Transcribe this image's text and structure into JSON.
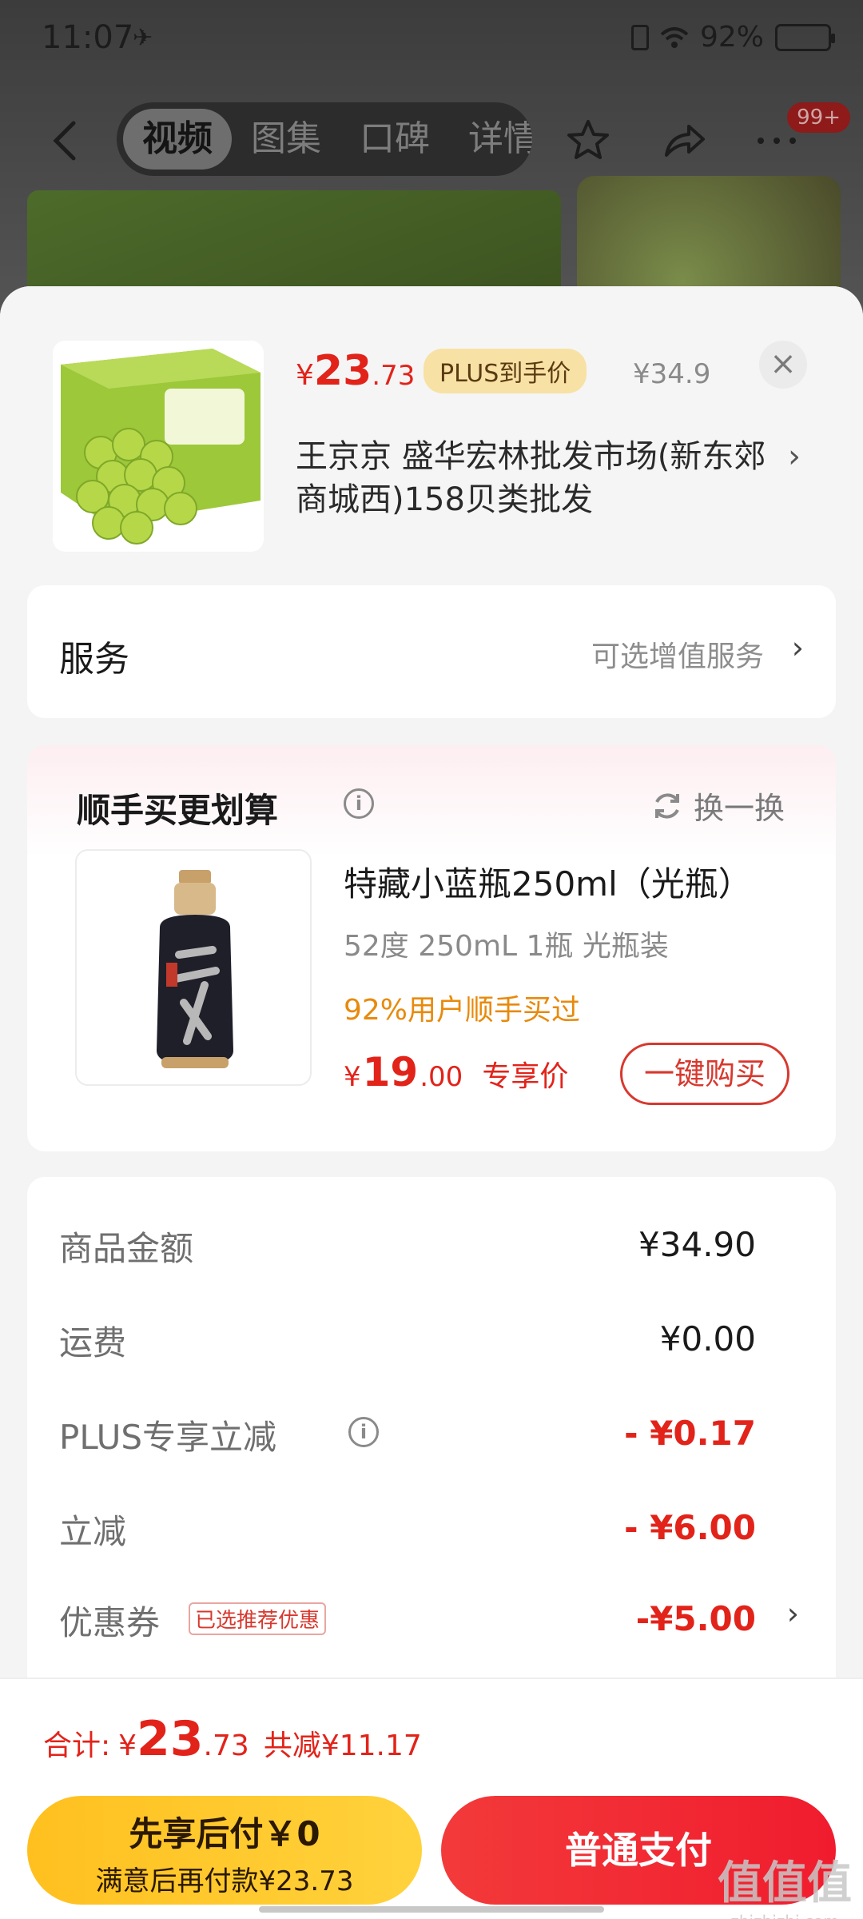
{
  "status_bar": {
    "time": "11:07",
    "battery": "92%",
    "battery_level": 0.92
  },
  "nav": {
    "tabs": [
      "视频",
      "图集",
      "口碑",
      "详情"
    ],
    "active_tab": 0,
    "badge": "99+"
  },
  "product": {
    "price_yen": "¥",
    "price_int": "23",
    "price_dec": ".73",
    "plus_tag": "PLUS到手价",
    "orig_price": "¥34.9",
    "close": "×",
    "shop_name": "王京京  盛华宏林批发市场(新东郊商城西)158贝类批发",
    "shop_arrow": "›"
  },
  "service": {
    "title": "服务",
    "value": "可选增值服务",
    "arrow": "›"
  },
  "combo": {
    "title": "顺手买更划算",
    "info": "i",
    "refresh": "换一换",
    "item": {
      "name": "特藏小蓝瓶250ml（光瓶）",
      "spec": "52度 250mL 1瓶 光瓶装",
      "percent": "92%用户顺手买过",
      "price_yen": "¥",
      "price_int": "19",
      "price_dec": ".00",
      "price_label": "专享价",
      "buy_label": "一键购买"
    }
  },
  "amounts": {
    "goods": {
      "label": "商品金额",
      "value": "¥34.90"
    },
    "shipping": {
      "label": "运费",
      "value": "¥0.00"
    },
    "plus_discount": {
      "label": "PLUS专享立减",
      "value": "- ¥0.17"
    },
    "discount": {
      "label": "立减",
      "value": "- ¥6.00"
    },
    "coupon": {
      "label": "优惠券",
      "tag": "已选推荐优惠",
      "value": "-¥5.00",
      "arrow": "›"
    }
  },
  "total": {
    "label": "合计:",
    "yen": "¥",
    "int": "23",
    "dec": ".73",
    "saved": "共减¥11.17"
  },
  "pay": {
    "later_line1": "先享后付￥0",
    "later_line2": "满意后再付款¥23.73",
    "normal": "普通支付"
  },
  "watermark": {
    "main": "值值值",
    "sub": "zhizhizhi.com"
  },
  "colors": {
    "accent_red": "#e2231a",
    "plus_gold": "#f8e1a4",
    "pay_yellow": "#ffc01f",
    "pay_red": "#f01c2e",
    "orange_text": "#e88a0c"
  }
}
